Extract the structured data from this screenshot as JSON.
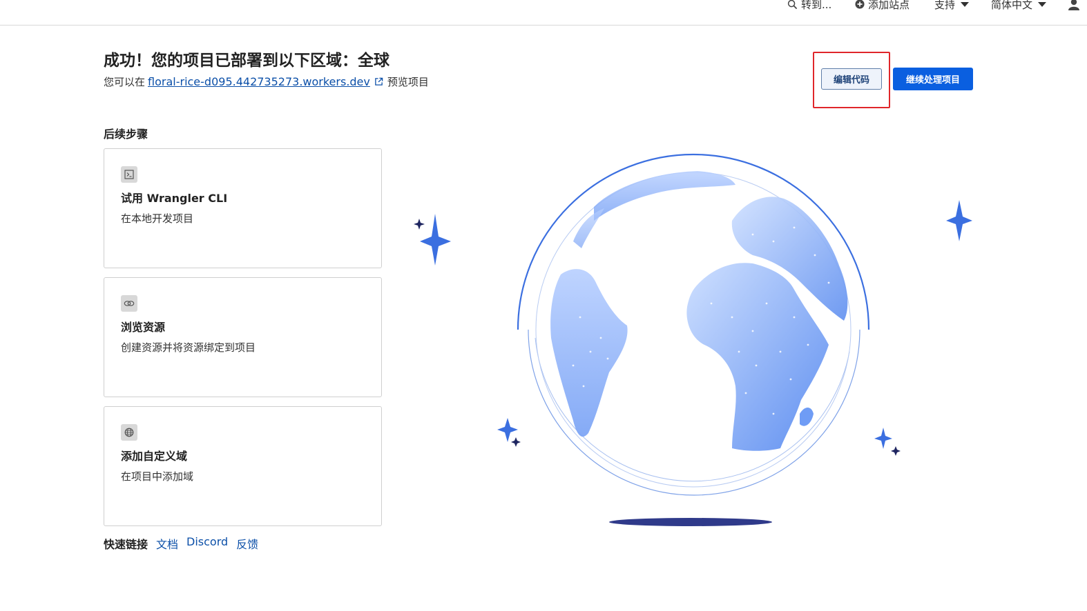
{
  "header": {
    "search_label": "转到...",
    "add_site_label": "添加站点",
    "support_label": "支持",
    "language_label": "简体中文"
  },
  "main": {
    "title": "成功！您的项目已部署到以下区域：全球",
    "preview_prefix": "您可以在",
    "preview_url": "floral-rice-d095.442735273.workers.dev",
    "preview_suffix": "预览项目",
    "edit_code_label": "编辑代码",
    "continue_label": "继续处理项目"
  },
  "next_steps": {
    "title": "后续步骤",
    "cards": [
      {
        "title": "试用 Wrangler CLI",
        "desc": "在本地开发项目",
        "icon": "terminal-icon"
      },
      {
        "title": "浏览资源",
        "desc": "创建资源并将资源绑定到项目",
        "icon": "link-icon"
      },
      {
        "title": "添加自定义域",
        "desc": "在项目中添加域",
        "icon": "globe-icon"
      }
    ]
  },
  "quick_links": {
    "label": "快速链接",
    "links": [
      "文档",
      "Discord",
      "反馈"
    ]
  },
  "colors": {
    "accent": "#0a5fe0",
    "link": "#0b4fa8",
    "highlight": "#e0262a",
    "globe": "#6f9cf5"
  }
}
